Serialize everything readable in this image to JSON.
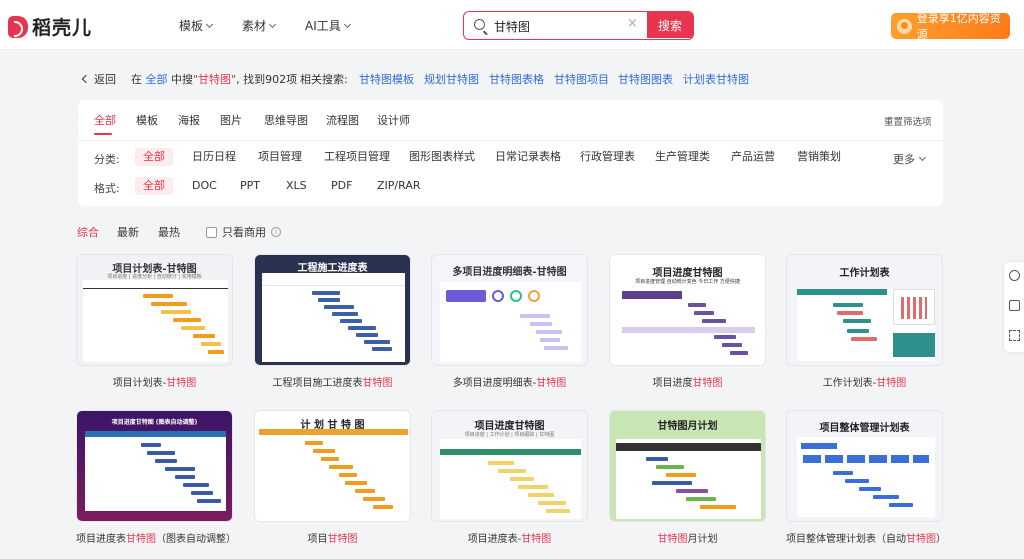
{
  "brand": {
    "name": "稻壳儿"
  },
  "nav": [
    {
      "label": "模板"
    },
    {
      "label": "素材"
    },
    {
      "label": "AI工具"
    }
  ],
  "search": {
    "value": "甘特图",
    "button": "搜索"
  },
  "login": {
    "label": "登录享1亿内容资源"
  },
  "breadcrumb": {
    "back": "返回",
    "prefix": "在",
    "scope": "全部",
    "middle": "中搜",
    "keyword": "\"甘特图\"",
    "suffix": ", 找到902项",
    "related_label": "相关搜索:",
    "related": [
      "甘特图模板",
      "规划甘特图",
      "甘特图表格",
      "甘特图项目",
      "甘特图图表",
      "计划表甘特图"
    ]
  },
  "tabs": [
    "全部",
    "模板",
    "海报",
    "图片",
    "思维导图",
    "流程图",
    "设计师"
  ],
  "reset_label": "重置筛选项",
  "category": {
    "label": "分类:",
    "items": [
      "全部",
      "日历日程",
      "项目管理",
      "工程项目管理",
      "图形图表样式",
      "日常记录表格",
      "行政管理表",
      "生产管理类",
      "产品运营",
      "营销策划"
    ],
    "more": "更多"
  },
  "format": {
    "label": "格式:",
    "items": [
      "全部",
      "DOC",
      "PPT",
      "XLS",
      "PDF",
      "ZIP/RAR"
    ]
  },
  "sort": {
    "items": [
      "综合",
      "最新",
      "最热"
    ],
    "commercial_label": "只看商用",
    "info_icon": "ⓘ"
  },
  "cards": [
    {
      "title": "项目计划表-甘特图",
      "sub": "项目进度 | 进度分析 | 自动统计 | 实用模板",
      "caption_pre": "项目计划表-",
      "caption_hl": "甘特图",
      "caption_post": ""
    },
    {
      "title": "工程施工进度表",
      "sub": "",
      "caption_pre": "工程项目施工进度表",
      "caption_hl": "甘特图",
      "caption_post": ""
    },
    {
      "title": "多项目进度明细表-甘特图",
      "sub": "",
      "caption_pre": "多项目进度明细表-",
      "caption_hl": "甘特图",
      "caption_post": ""
    },
    {
      "title": "项目进度甘特图",
      "sub": "项目进度管理 自动统计变色 今日工作 方便快捷",
      "caption_pre": "项目进度",
      "caption_hl": "甘特图",
      "caption_post": ""
    },
    {
      "title": "工作计划表",
      "sub": "",
      "caption_pre": "工作计划表-",
      "caption_hl": "甘特图",
      "caption_post": ""
    },
    {
      "title": "项目进度甘特图 (图表自动调整)",
      "sub": "",
      "caption_pre": "项目进度表",
      "caption_hl": "甘特图",
      "caption_post": "（图表自动调整）"
    },
    {
      "title": "计 划 甘 特 图",
      "sub": "",
      "caption_pre": "项目",
      "caption_hl": "甘特图",
      "caption_post": ""
    },
    {
      "title": "项目进度甘特图",
      "sub": "项目进度 | 工作计划 | 项目跟踪 | 甘特图",
      "caption_pre": "项目进度表-",
      "caption_hl": "甘特图",
      "caption_post": ""
    },
    {
      "title": "甘特图月计划",
      "sub": "",
      "caption_pre": "",
      "caption_hl": "甘特图",
      "caption_post": "月计划"
    },
    {
      "title": "项目整体管理计划表",
      "sub": "",
      "caption_pre": "项目整体管理计划表（自动",
      "caption_hl": "甘特图",
      "caption_post": "）"
    }
  ],
  "colors": {
    "accent": "#e8344e",
    "link": "#2f6bd8",
    "orange": "#ff8c1a"
  }
}
